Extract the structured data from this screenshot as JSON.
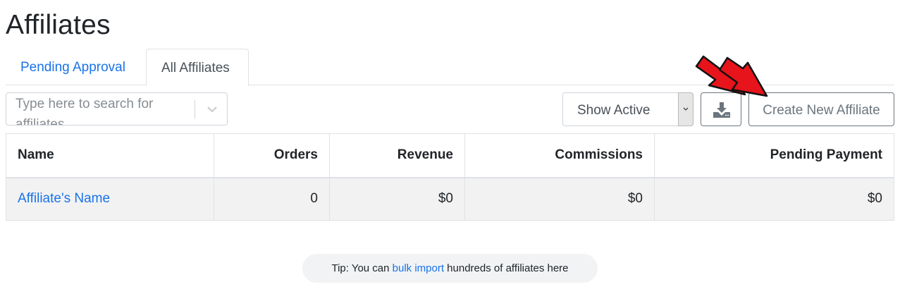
{
  "page": {
    "title": "Affiliates"
  },
  "tabs": [
    {
      "label": "Pending Approval",
      "active": false
    },
    {
      "label": "All Affiliates",
      "active": true
    }
  ],
  "search": {
    "placeholder": "Type here to search for affiliates"
  },
  "filter": {
    "selected": "Show Active"
  },
  "toolbar": {
    "download_icon": "download-icon",
    "create_label": "Create New Affiliate"
  },
  "annotation": {
    "arrow_color": "#e8141b"
  },
  "table": {
    "headers": [
      "Name",
      "Orders",
      "Revenue",
      "Commissions",
      "Pending Payment"
    ],
    "rows": [
      {
        "name": "Affiliate's Name",
        "orders": "0",
        "revenue": "$0",
        "commissions": "$0",
        "pending": "$0"
      }
    ]
  },
  "tip": {
    "prefix": "Tip: You can ",
    "link": "bulk import",
    "suffix": " hundreds of affiliates here"
  },
  "colors": {
    "link": "#1a73e8",
    "border": "#dee2e6",
    "button": "#6c757d"
  }
}
